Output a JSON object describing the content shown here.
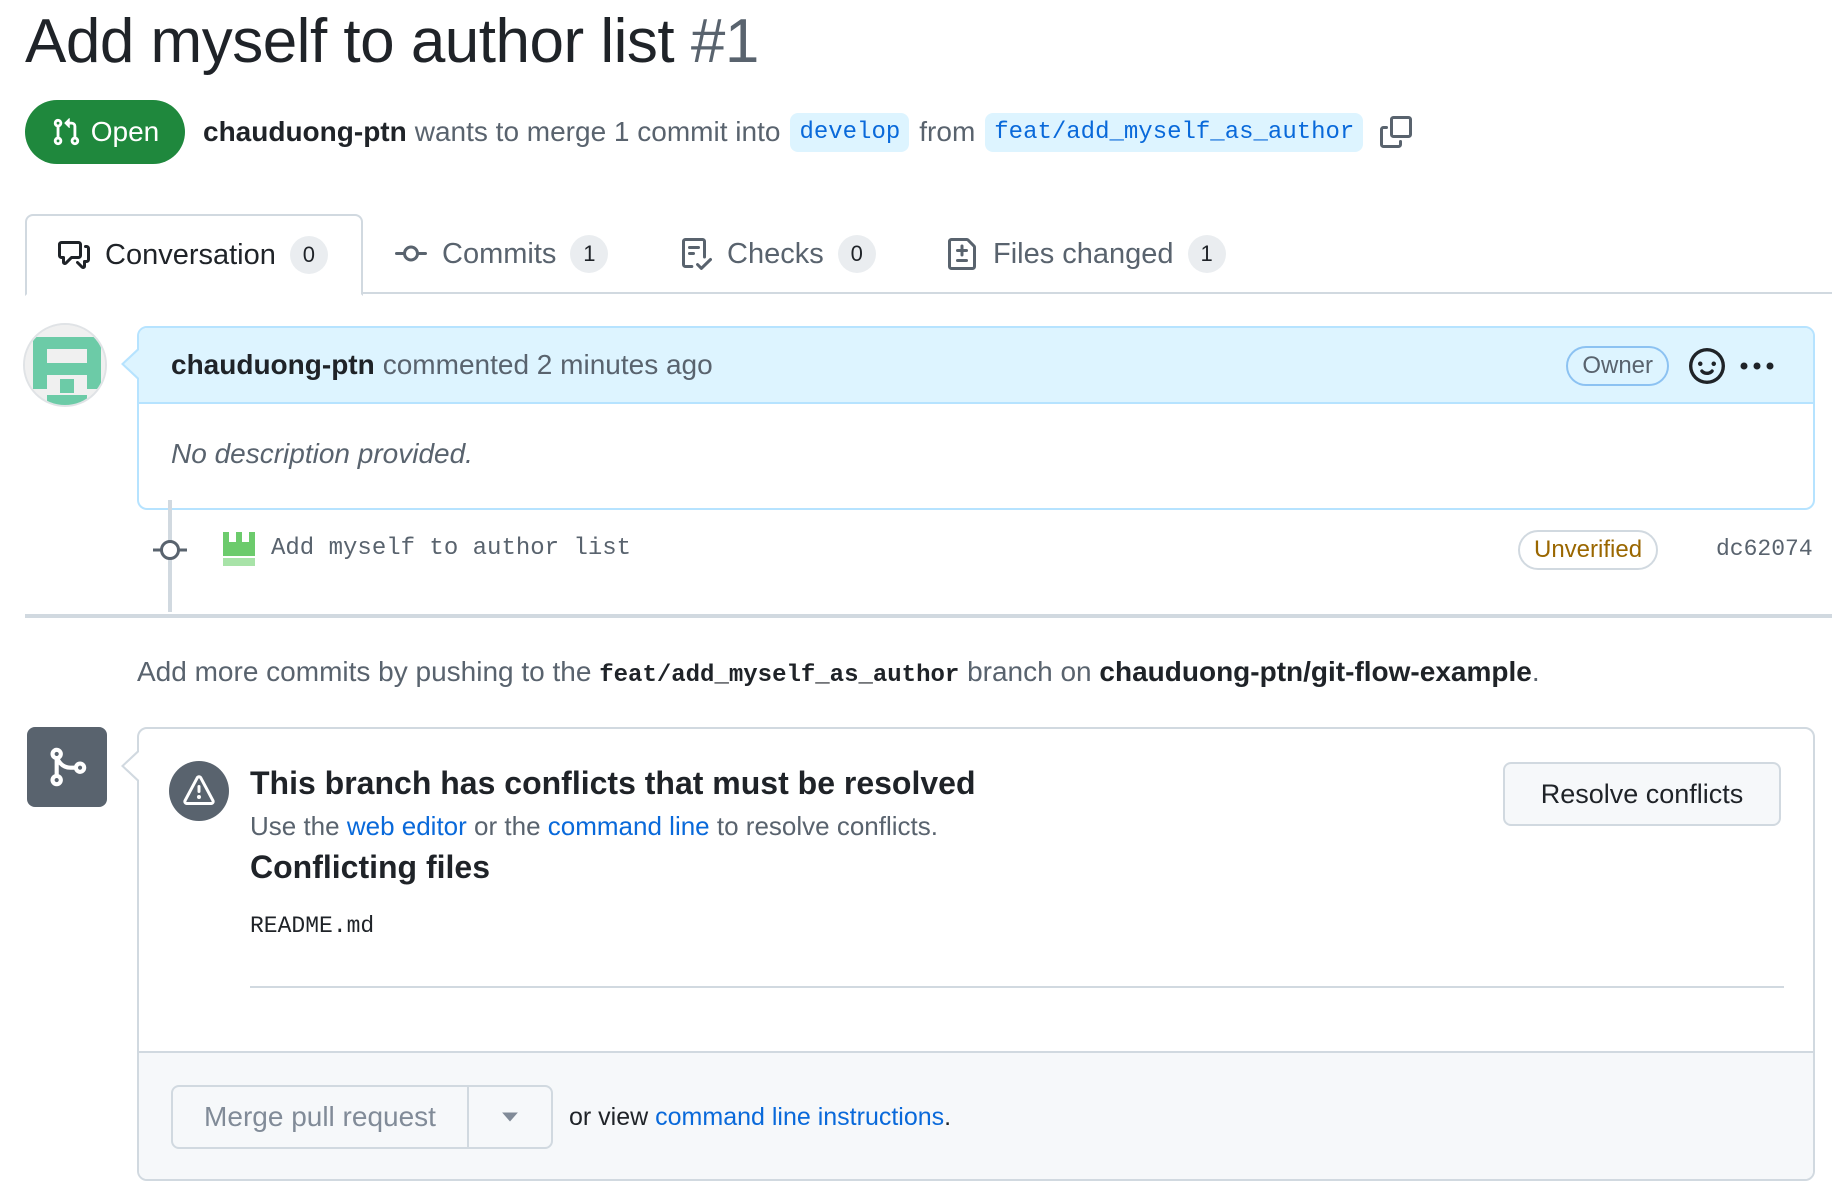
{
  "pr": {
    "title": "Add myself to author list",
    "number": "#1",
    "state": "Open",
    "author": "chauduong-ptn",
    "merge_text": "wants to merge 1 commit into",
    "base_branch": "develop",
    "from_text": "from",
    "head_branch": "feat/add_myself_as_author"
  },
  "tabs": [
    {
      "label": "Conversation",
      "count": "0",
      "icon": "comment-discussion-icon"
    },
    {
      "label": "Commits",
      "count": "1",
      "icon": "git-commit-icon"
    },
    {
      "label": "Checks",
      "count": "0",
      "icon": "checklist-icon"
    },
    {
      "label": "Files changed",
      "count": "1",
      "icon": "file-diff-icon"
    }
  ],
  "comment": {
    "author": "chauduong-ptn",
    "meta": "commented 2 minutes ago",
    "role": "Owner",
    "body": "No description provided."
  },
  "commit": {
    "message": "Add myself to author list",
    "verification": "Unverified",
    "sha": "dc62074"
  },
  "push_note": {
    "prefix": "Add more commits by pushing to the",
    "branch": "feat/add_myself_as_author",
    "middle": "branch on",
    "repo": "chauduong-ptn/git-flow-example",
    "suffix": "."
  },
  "merge": {
    "conflict_title": "This branch has conflicts that must be resolved",
    "sub_prefix": "Use the",
    "web_editor": "web editor",
    "sub_or": "or the",
    "command_line": "command line",
    "sub_suffix": "to resolve conflicts.",
    "files_title": "Conflicting files",
    "files": [
      "README.md"
    ],
    "resolve_button": "Resolve conflicts",
    "merge_button": "Merge pull request",
    "or_view": "or view",
    "cli_instructions": "command line instructions",
    "period": "."
  },
  "colors": {
    "open_green": "#1f883d",
    "link_blue": "#0969da",
    "owner_bg": "#ddf4ff",
    "unverified": "#9a6700"
  }
}
